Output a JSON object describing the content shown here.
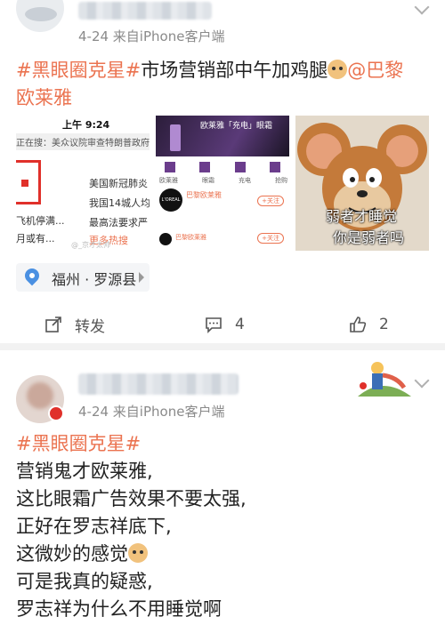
{
  "post1": {
    "time_source": "4-24  来自iPhone客户端",
    "line1_tag": "#黑眼圈克星#",
    "line1_text": "市场营销部中午加鸡腿",
    "line1_mention": "@巴黎",
    "line2": "欧莱雅",
    "thumb1": {
      "status_time": "上午 9:24",
      "header_line": "正在搜：美众议院审查特朗普政府疫",
      "news": [
        "美国新冠肺炎",
        "我国14城人均",
        "最高法要求严"
      ],
      "side_text": [
        "飞机停满...",
        "月或有..."
      ],
      "more": "更多热搜",
      "watermark": "@_京才太帅"
    },
    "thumb2": {
      "banner": "欧莱雅「充电」眼霜",
      "tabs": [
        "欧莱雅",
        "眼霜",
        "充电",
        "抢购"
      ],
      "brand": "L'OREAL",
      "name": "巴黎欧莱雅",
      "follow": "+关注",
      "row2": "巴黎欧莱雅"
    },
    "thumb3": {
      "caption1": "弱者才睡觉",
      "caption2": "你是弱者吗"
    },
    "location": "福州 · 罗源县",
    "actions": {
      "repost": "转发",
      "comments": "4",
      "likes": "2"
    }
  },
  "post2": {
    "time_source": "4-24  来自iPhone客户端",
    "tag": "#黑眼圈克星#",
    "lines": [
      "营销鬼才欧莱雅,",
      "这比眼霜广告效果不要太强,",
      "正好在罗志祥底下,",
      "这微妙的感觉",
      "可是我真的疑惑,",
      "罗志祥为什么不用睡觉啊"
    ]
  },
  "colors": {
    "tag": "#eb7350",
    "meta": "#8a8a8a",
    "separator": "#f2f2f2",
    "location_pin": "#4a90e2"
  }
}
